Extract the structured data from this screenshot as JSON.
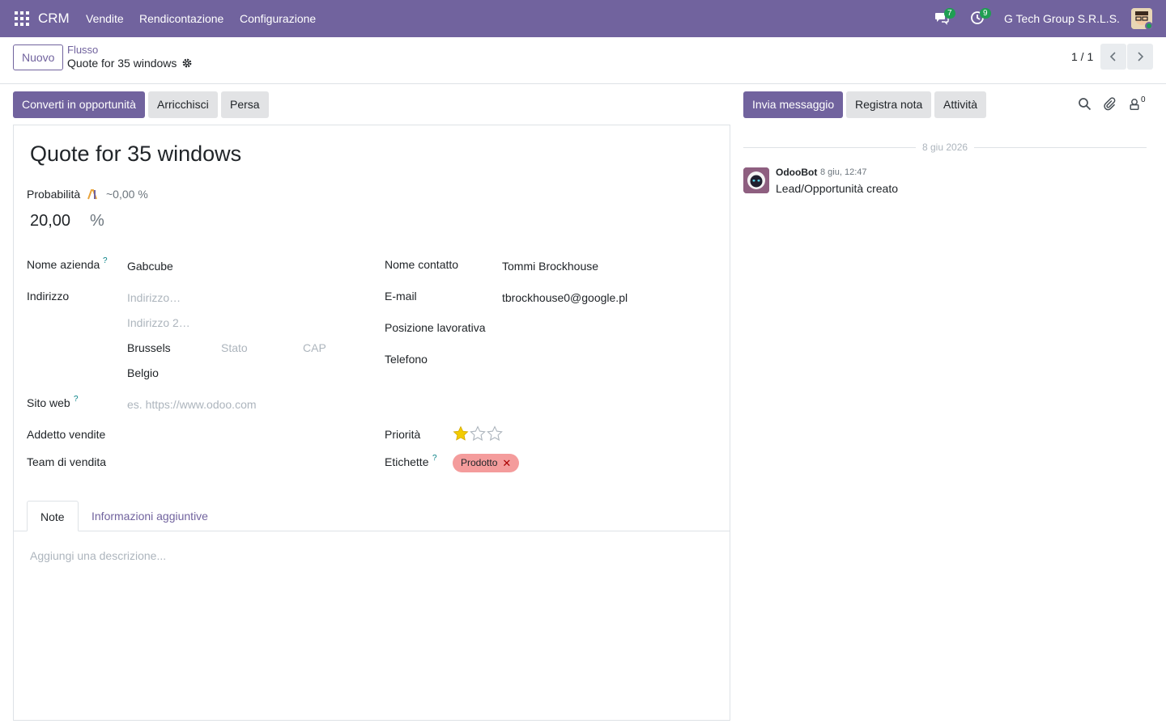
{
  "navbar": {
    "brand": "CRM",
    "menu": [
      "Vendite",
      "Rendicontazione",
      "Configurazione"
    ],
    "messages_badge": "7",
    "activities_badge": "9",
    "company": "G Tech Group S.R.L.S."
  },
  "control": {
    "new_label": "Nuovo",
    "breadcrumb_parent": "Flusso",
    "breadcrumb_current": "Quote for 35 windows",
    "pager": "1 / 1"
  },
  "actions": {
    "convert": "Converti in opportunità",
    "enrich": "Arricchisci",
    "lost": "Persa"
  },
  "form": {
    "title": "Quote for 35 windows",
    "probability_label": "Probabilità",
    "probability_ai": "~0,00 %",
    "probability_value": "20,00",
    "probability_unit": "%",
    "company_label": "Nome azienda",
    "company_value": "Gabcube",
    "address_label": "Indirizzo",
    "street_placeholder": "Indirizzo…",
    "street2_placeholder": "Indirizzo 2…",
    "city": "Brussels",
    "state_placeholder": "Stato",
    "zip_placeholder": "CAP",
    "country": "Belgio",
    "website_label": "Sito web",
    "website_placeholder": "es. https://www.odoo.com",
    "salesperson_label": "Addetto vendite",
    "team_label": "Team di vendita",
    "contact_label": "Nome contatto",
    "contact_value": "Tommi Brockhouse",
    "email_label": "E-mail",
    "email_value": "tbrockhouse0@google.pl",
    "job_label": "Posizione lavorativa",
    "phone_label": "Telefono",
    "priority_label": "Priorità",
    "priority_value": 1,
    "priority_max": 3,
    "tags_label": "Etichette",
    "tag": "Prodotto",
    "help_mark": "?"
  },
  "tabs": {
    "notes": "Note",
    "extra": "Informazioni aggiuntive",
    "notes_placeholder": "Aggiungi una descrizione..."
  },
  "chatter": {
    "send_message": "Invia messaggio",
    "log_note": "Registra nota",
    "activities": "Attività",
    "followers": "0",
    "date_separator": "8 giu 2026",
    "message": {
      "author": "OdooBot",
      "date": "8 giu, 12:47",
      "body": "Lead/Opportunità creato"
    }
  },
  "colors": {
    "brand": "#71639e",
    "badge": "#1f9e52",
    "tag": "#f49c9c",
    "star": "#f3cc00"
  }
}
